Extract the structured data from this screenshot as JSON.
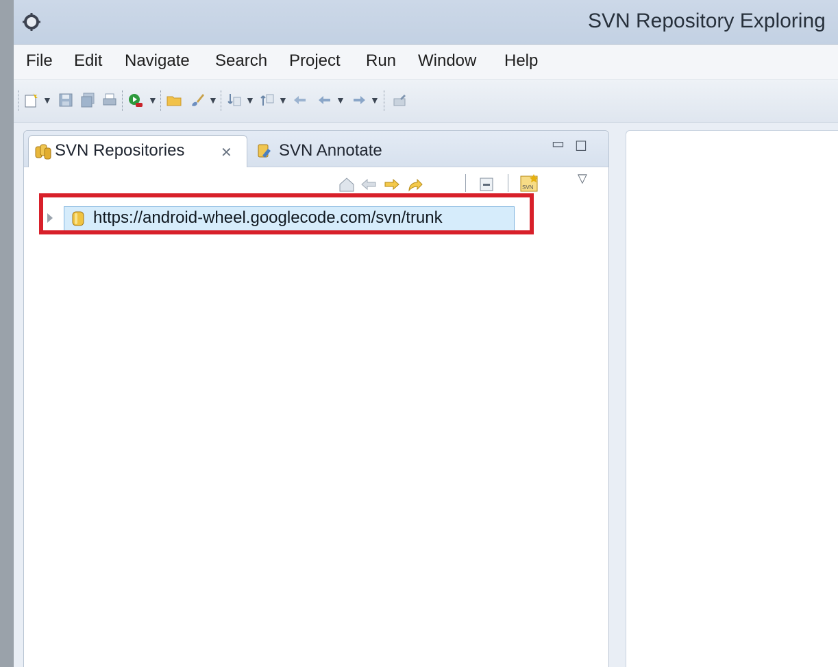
{
  "window": {
    "title": "SVN Repository Exploring",
    "icon": "eclipse-gear-icon"
  },
  "menubar": {
    "items": [
      "File",
      "Edit",
      "Navigate",
      "Search",
      "Project",
      "Run",
      "Window",
      "Help"
    ]
  },
  "toolbar": {
    "icons": [
      "new-icon",
      "save-icon",
      "save-all-icon",
      "print-icon",
      "run-icon",
      "open-folder-icon",
      "brush-icon",
      "next-annotation-icon",
      "prev-annotation-icon",
      "back-icon",
      "back-history-icon",
      "forward-icon",
      "pin-icon"
    ]
  },
  "left_panel": {
    "tabs": [
      {
        "label": "SVN Repositories",
        "active": true,
        "icon": "svn-repositories-icon"
      },
      {
        "label": "SVN Annotate",
        "active": false,
        "icon": "svn-annotate-icon"
      }
    ],
    "view_toolbar_icons": [
      "home-icon",
      "back-icon",
      "forward-icon",
      "go-up-icon",
      "collapse-all-icon",
      "new-repository-location-icon",
      "view-menu-icon"
    ],
    "tree": [
      {
        "label": "https://android-wheel.googlecode.com/svn/trunk",
        "icon": "repository-icon",
        "expanded": false,
        "selected": true
      }
    ]
  },
  "annotation": {
    "color": "#d8202a"
  }
}
